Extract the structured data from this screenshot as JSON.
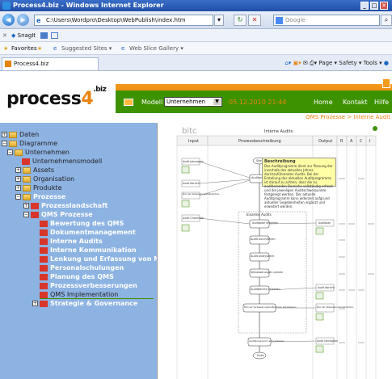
{
  "window": {
    "title": "Process4.biz - Windows Internet Explorer",
    "controls": [
      "_",
      "□",
      "✕"
    ]
  },
  "addressbar": {
    "url": "C:\\Users\\Wordpro\\Desktop\\WebPublish\\index.htm",
    "search_placeholder": "Google"
  },
  "toolbar": {
    "snagit": "SnagIt"
  },
  "favorites": {
    "label": "Favorites",
    "items": [
      "Suggested Sites ▾",
      "Web Slice Gallery ▾"
    ]
  },
  "tab": {
    "label": "Process4.biz"
  },
  "commandbar": {
    "items": [
      "Page ▾",
      "Safety ▾",
      "Tools ▾"
    ]
  },
  "page": {
    "logo_text": "process",
    "logo_four": "4",
    "logo_biz": ".biz",
    "model_label": "Modell",
    "model_select": "Unternehmen",
    "date": "05.12.2010 21:44",
    "nav": [
      "Home",
      "Kontakt",
      "Hilfe"
    ],
    "breadcrumb": "QMS Prozesse > Interne Audit"
  },
  "tree": {
    "items": [
      {
        "label": "Daten"
      },
      {
        "label": "Diagramme"
      },
      {
        "label": "Unternehmen"
      },
      {
        "label": "Unternehmensmodell"
      },
      {
        "label": "Assets"
      },
      {
        "label": "Organisation"
      },
      {
        "label": "Produkte"
      },
      {
        "label": "Prozesse"
      },
      {
        "label": "Prozesslandschaft"
      },
      {
        "label": "QMS Prozesse"
      },
      {
        "label": "Bewertung des QMS"
      },
      {
        "label": "Dokumentmanagement"
      },
      {
        "label": "Interne Audits"
      },
      {
        "label": "Interne Kommunikation"
      },
      {
        "label": "Lenkung und Erfassung von Me"
      },
      {
        "label": "Personalschulungen"
      },
      {
        "label": "Planung des QMS"
      },
      {
        "label": "Prozessverbesserungen"
      },
      {
        "label": "QMS Implementation"
      },
      {
        "label": "Strategie & Governance"
      }
    ]
  },
  "diagram": {
    "brand": "bitc",
    "title": "Interne Audits",
    "columns": [
      "Input",
      "Prozessbeschreibung",
      "Output",
      "R",
      "A",
      "C",
      "I"
    ],
    "group_label": "Einzelne Audits",
    "tooltip_title": "Beschreibung",
    "tooltip_text": "Das Auditprogramm dient zur Planung der innerhalb des aktuellen Jahres durchzuführenden Audits. Bei der Erstellung des aktuellen Auditprogramms ist darauf zu achten, dass die zu auditierenden Bereiche vollständig erfasst und die jeweiligen Auditschwerpunkte festgelegt werden. Der aktuelle Auditprogramm kann jederzeit aufgrund aktueller Gegebenheiten ergänzt und erweitert werden.",
    "inputs": [
      "Audit Jahresplan",
      "Audit Bericht",
      "Plan der Verbesserungsmaßnahmen",
      "Audit Checkliste"
    ],
    "steps": [
      "Start",
      "Auditprogramm erstellen",
      "Auditplan erstellen",
      "Audit durchführen",
      "Audit analysieren",
      "Verbesserungen planen",
      "Auditbericht erstellen",
      "Plan der Verbesserungsmaßnahmen aktualisieren",
      "Auditprogramm aktualisieren",
      "Ende"
    ],
    "outputs": [
      "Auditplan",
      "Audit Bericht",
      "Plan der Verbesserungsmaßnahmen",
      "Audit Jahresplan"
    ]
  },
  "colors": {
    "sidebar": "#8db3e2",
    "orange": "#e8830f",
    "green": "#3d9200",
    "titlebar": "#214fa7"
  }
}
